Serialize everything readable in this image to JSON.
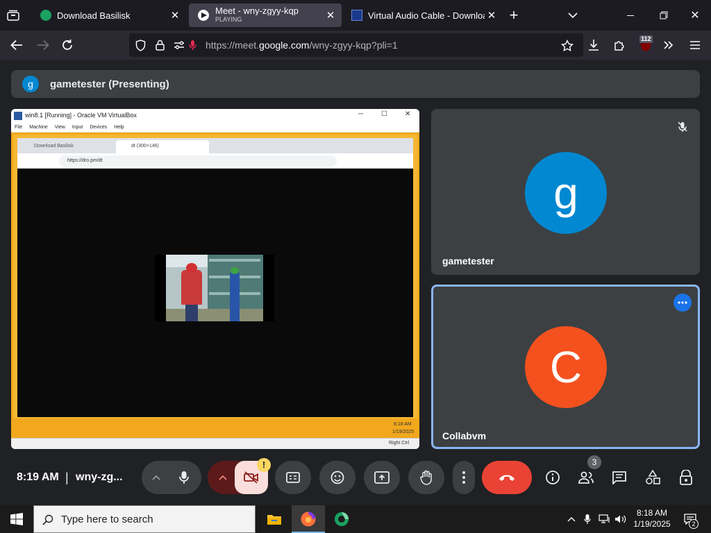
{
  "browser": {
    "tabs": [
      {
        "title": "Download Basilisk",
        "active": false
      },
      {
        "title": "Meet - wny-zgyy-kqp",
        "subtitle": "PLAYING",
        "active": true
      },
      {
        "title": "Virtual Audio Cable - Download",
        "active": false
      }
    ],
    "url_prefix": "https://meet.",
    "url_domain": "google.com",
    "url_suffix": "/wny-zgyy-kqp?pli=1",
    "badge_count": "112"
  },
  "meet": {
    "presenter_initial": "g",
    "presenter_label": "gametester (Presenting)",
    "participants": [
      {
        "name": "gametester",
        "initial": "g",
        "color": "#0288d1",
        "muted": true
      },
      {
        "name": "Collabvm",
        "initial": "C",
        "color": "#f4511e",
        "muted": false
      }
    ],
    "time": "8:19 AM",
    "separator": "|",
    "meeting_code": "wny-zg...",
    "people_count": "3",
    "camera_warning": "!"
  },
  "shared_screen": {
    "vm_title": "win8.1 [Running] - Oracle VM VirtualBox",
    "vm_menu": [
      "File",
      "Machine",
      "View",
      "Input",
      "Devices",
      "Help"
    ],
    "inner_tabs": [
      "Download Basilisk",
      "dt (300×146)"
    ],
    "inner_url": "https://dro.pm/dt",
    "inner_clock_time": "8:18 AM",
    "inner_clock_date": "1/19/2025",
    "right_ctrl": "Right Ctrl"
  },
  "taskbar": {
    "search_placeholder": "Type here to search",
    "clock_time": "8:18 AM",
    "clock_date": "1/19/2025",
    "notification_count": "2"
  }
}
